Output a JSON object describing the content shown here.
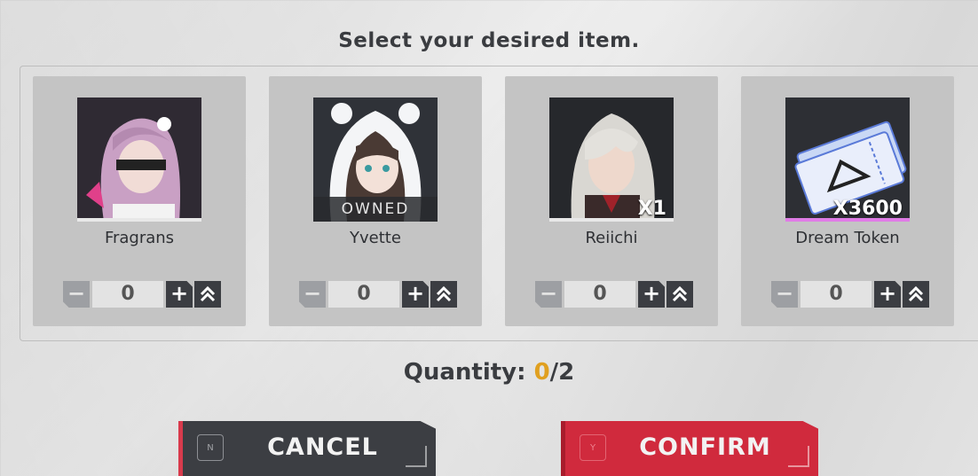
{
  "title": "Select your desired item.",
  "items": [
    {
      "name": "Fragrans",
      "badge": "",
      "owned": "",
      "value": "0"
    },
    {
      "name": "Yvette",
      "badge": "",
      "owned": "OWNED",
      "value": "0"
    },
    {
      "name": "Reiichi",
      "badge": "X1",
      "owned": "",
      "value": "0"
    },
    {
      "name": "Dream Token",
      "badge": "X3600",
      "owned": "",
      "value": "0"
    }
  ],
  "stepper": {
    "minus": "−",
    "plus": "+"
  },
  "quantity": {
    "label": "Quantity:",
    "current": "0",
    "max": "/2"
  },
  "buttons": {
    "cancel": {
      "key": "N",
      "label": "CANCEL"
    },
    "confirm": {
      "key": "Y",
      "label": "CONFIRM"
    }
  },
  "colors": {
    "accent": "#e0a020",
    "confirm": "#d02a3d",
    "cancel": "#3c3e43"
  }
}
